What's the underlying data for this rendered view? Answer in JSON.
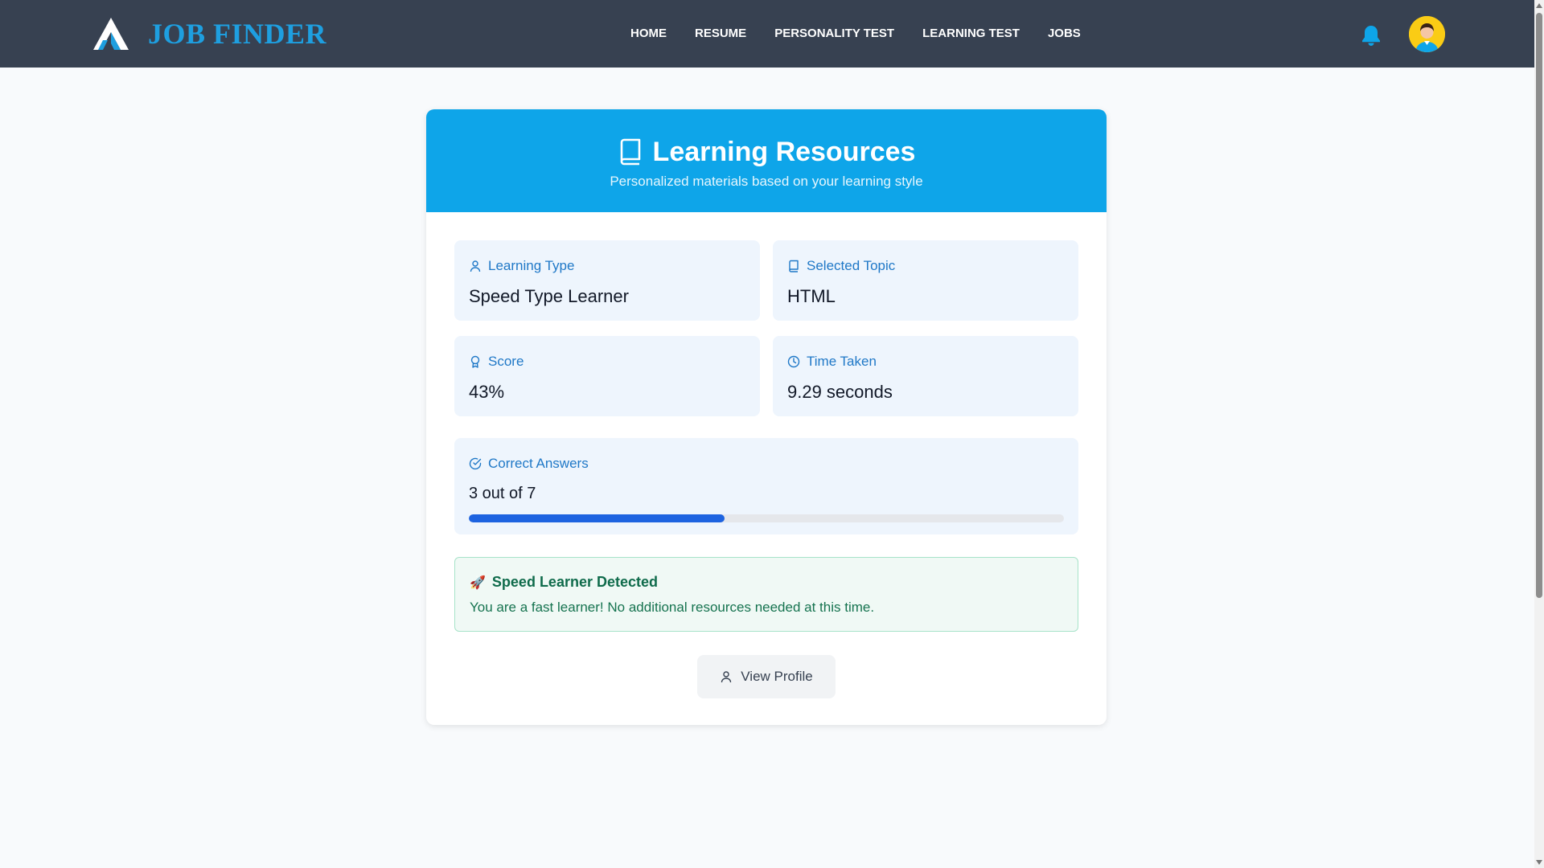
{
  "brand": {
    "name": "JOB FINDER",
    "color": "#1e9fe0"
  },
  "nav": {
    "links": [
      "HOME",
      "RESUME",
      "PERSONALITY TEST",
      "LEARNING TEST",
      "JOBS"
    ],
    "icons": [
      "bell-icon",
      "avatar"
    ]
  },
  "card": {
    "title": "Learning Resources",
    "subtitle": "Personalized materials based on your learning style",
    "header_color": "#0ea5e9"
  },
  "stats": {
    "learning_type": {
      "label": "Learning Type",
      "value": "Speed Type Learner",
      "icon": "user-icon"
    },
    "selected_topic": {
      "label": "Selected Topic",
      "value": "HTML",
      "icon": "book-icon"
    },
    "score": {
      "label": "Score",
      "value": "43%",
      "icon": "award-icon"
    },
    "time_taken": {
      "label": "Time Taken",
      "value": "9.29 seconds",
      "icon": "clock-icon"
    }
  },
  "correct_answers": {
    "label": "Correct Answers",
    "value": "3 out of 7",
    "progress_fraction": 0.43,
    "icon": "check-circle-icon",
    "progress_color": "#1d63e0"
  },
  "alert": {
    "title": "Speed Learner Detected",
    "icon": "rocket-icon",
    "message": "You are a fast learner! No additional resources needed at this time."
  },
  "actions": {
    "view_profile": "View Profile"
  }
}
